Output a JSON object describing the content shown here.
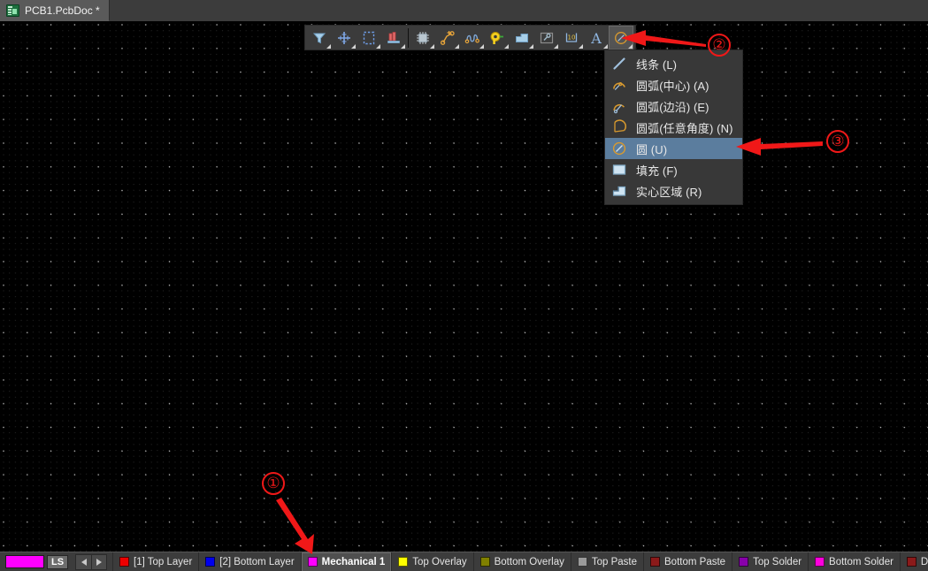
{
  "window": {
    "document_tab": {
      "label": "PCB1.PcbDoc *",
      "icon": "pcb-document-icon"
    }
  },
  "toolbar": {
    "name": "PCB drawing tools toolbar",
    "buttons": [
      {
        "name": "filter-tool",
        "icon": "funnel-icon",
        "selected": false,
        "has_dropdown": true
      },
      {
        "name": "place-crosshair-tool",
        "icon": "crosshair-plus-icon",
        "selected": false,
        "has_dropdown": true
      },
      {
        "name": "area-select-tool",
        "icon": "dashed-rectangle-icon",
        "selected": false,
        "has_dropdown": true
      },
      {
        "name": "place-pad-tool",
        "icon": "pad-bars-icon",
        "selected": false,
        "has_dropdown": true
      },
      {
        "name": "place-component-tool",
        "icon": "chip-ic-icon",
        "selected": false,
        "has_dropdown": true
      },
      {
        "name": "place-track-tool",
        "icon": "track-route-icon",
        "selected": false,
        "has_dropdown": true
      },
      {
        "name": "place-differential-pair-tool",
        "icon": "squiggle-pair-icon",
        "selected": false,
        "has_dropdown": true
      },
      {
        "name": "place-via-tool",
        "icon": "via-keyhole-icon",
        "selected": false,
        "has_dropdown": true
      },
      {
        "name": "place-polygon-tool",
        "icon": "polygon-fill-icon",
        "selected": false,
        "has_dropdown": true
      },
      {
        "name": "place-keepout-tool",
        "icon": "keepout-wrench-icon",
        "selected": false,
        "has_dropdown": true
      },
      {
        "name": "place-dimension-tool",
        "icon": "dimension-10-icon",
        "selected": false,
        "has_dropdown": true
      },
      {
        "name": "place-string-tool",
        "icon": "text-letter-a-icon",
        "selected": false,
        "has_dropdown": true
      },
      {
        "name": "place-arc-circle-tool",
        "icon": "circle-arc-icon",
        "selected": true,
        "has_dropdown": true
      }
    ]
  },
  "menu": {
    "name": "arc-and-shape-dropdown-menu",
    "items": [
      {
        "icon": "line-icon",
        "label": "线条 (L)",
        "active": false
      },
      {
        "icon": "arc-center-icon",
        "label": "圆弧(中心) (A)",
        "active": false
      },
      {
        "icon": "arc-edge-icon",
        "label": "圆弧(边沿) (E)",
        "active": false
      },
      {
        "icon": "arc-any-angle-icon",
        "label": "圆弧(任意角度) (N)",
        "active": false
      },
      {
        "icon": "circle-icon",
        "label": "圆 (U)",
        "active": true
      },
      {
        "icon": "fill-icon",
        "label": "填充 (F)",
        "active": false
      },
      {
        "icon": "solid-region-icon",
        "label": "实心区域 (R)",
        "active": false
      }
    ]
  },
  "annotations": {
    "color": "#f01818",
    "markers": [
      {
        "name": "marker-1",
        "label": "①",
        "points_to": "active-layer-tab-mechanical-1"
      },
      {
        "name": "marker-2",
        "label": "②",
        "points_to": "place-arc-circle-tool"
      },
      {
        "name": "marker-3",
        "label": "③",
        "points_to": "menu-item-circle"
      }
    ]
  },
  "layer_bar": {
    "name": "layer-tabs-bar",
    "current_color": "#ff00ff",
    "ls_button": "LS",
    "prev_label": "◀",
    "next_label": "▶",
    "layers": [
      {
        "name": "top-layer",
        "label": "[1] Top Layer",
        "color": "#ee0000",
        "active": false
      },
      {
        "name": "bottom-layer",
        "label": "[2] Bottom Layer",
        "color": "#0000ee",
        "active": false
      },
      {
        "name": "mechanical-1",
        "label": "Mechanical 1",
        "color": "#ff00ff",
        "active": true
      },
      {
        "name": "top-overlay",
        "label": "Top Overlay",
        "color": "#ffff00",
        "active": false
      },
      {
        "name": "bottom-overlay",
        "label": "Bottom Overlay",
        "color": "#808000",
        "active": false
      },
      {
        "name": "top-paste",
        "label": "Top Paste",
        "color": "#9a9a9a",
        "active": false
      },
      {
        "name": "bottom-paste",
        "label": "Bottom Paste",
        "color": "#8b1a1a",
        "active": false
      },
      {
        "name": "top-solder",
        "label": "Top Solder",
        "color": "#8800aa",
        "active": false
      },
      {
        "name": "bottom-solder",
        "label": "Bottom Solder",
        "color": "#ff00dd",
        "active": false
      },
      {
        "name": "drill-guide",
        "label": "Drill Guide",
        "color": "#8b1a1a",
        "active": false
      }
    ]
  },
  "colors": {
    "canvas_bg": "#000000",
    "chrome_bg": "#3c3c3c",
    "toolbar_bg": "#3b3b3b",
    "menu_bg": "#383838",
    "menu_highlight": "#5b7d9e",
    "annotation_red": "#f01818"
  }
}
